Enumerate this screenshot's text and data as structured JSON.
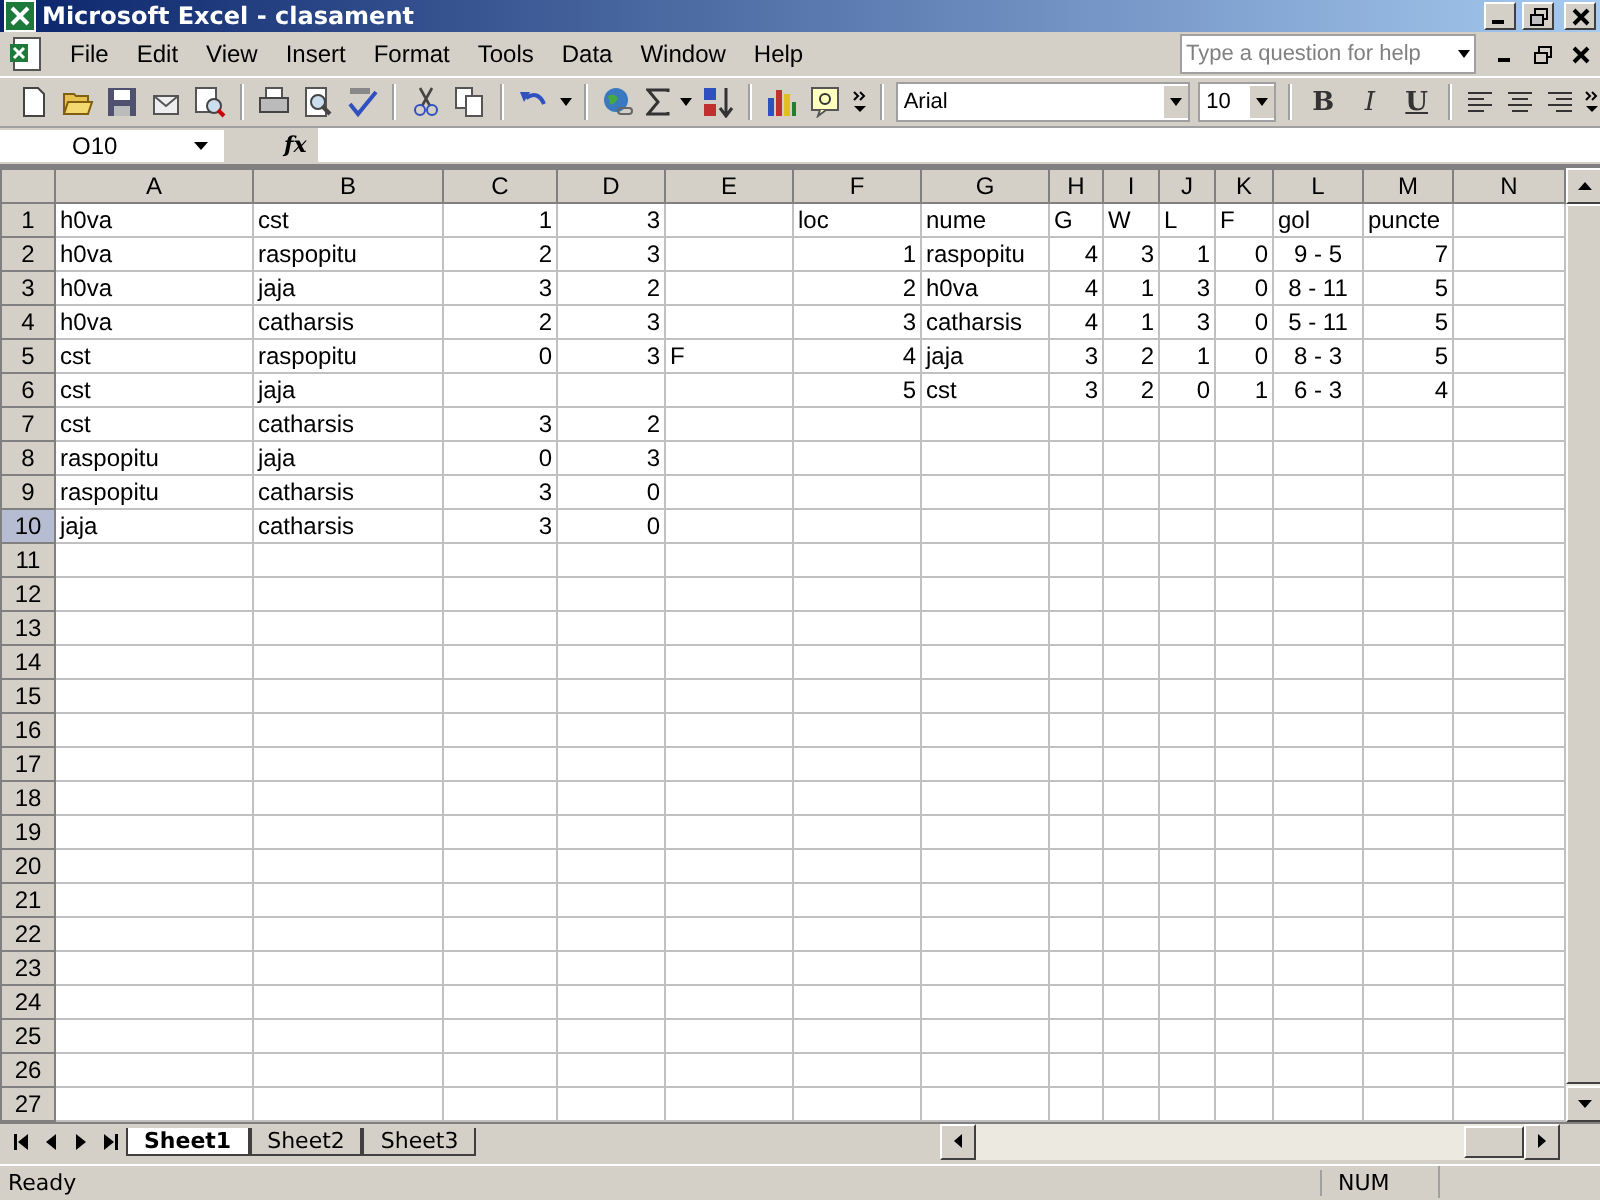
{
  "window": {
    "title": "Microsoft Excel - clasament"
  },
  "menu": [
    "File",
    "Edit",
    "View",
    "Insert",
    "Format",
    "Tools",
    "Data",
    "Window",
    "Help"
  ],
  "help_box": {
    "placeholder": "Type a question for help"
  },
  "formatting": {
    "font": "Arial",
    "size": "10",
    "bold": "B",
    "italic": "I",
    "underline": "U"
  },
  "formula_bar": {
    "name_box": "O10",
    "fx": "fx"
  },
  "columns": [
    "A",
    "B",
    "C",
    "D",
    "E",
    "F",
    "G",
    "H",
    "I",
    "J",
    "K",
    "L",
    "M",
    "N"
  ],
  "rows": [
    {
      "number": "1",
      "selected": false,
      "cells": [
        {
          "text": "h0va",
          "kind": "text"
        },
        {
          "text": "cst",
          "kind": "text"
        },
        {
          "text": "1",
          "kind": "number"
        },
        {
          "text": "3",
          "kind": "number"
        },
        null,
        {
          "text": "loc",
          "kind": "text"
        },
        {
          "text": "nume",
          "kind": "text"
        },
        {
          "text": "G",
          "kind": "text"
        },
        {
          "text": "W",
          "kind": "text"
        },
        {
          "text": "L",
          "kind": "text"
        },
        {
          "text": "F",
          "kind": "text"
        },
        {
          "text": "gol",
          "kind": "text"
        },
        {
          "text": "puncte",
          "kind": "text"
        }
      ]
    },
    {
      "number": "2",
      "selected": false,
      "cells": [
        {
          "text": "h0va",
          "kind": "text"
        },
        {
          "text": "raspopitu",
          "kind": "text"
        },
        {
          "text": "2",
          "kind": "number"
        },
        {
          "text": "3",
          "kind": "number"
        },
        null,
        {
          "text": "1",
          "kind": "number"
        },
        {
          "text": "raspopitu",
          "kind": "text"
        },
        {
          "text": "4",
          "kind": "number"
        },
        {
          "text": "3",
          "kind": "number"
        },
        {
          "text": "1",
          "kind": "number"
        },
        {
          "text": "0",
          "kind": "number"
        },
        {
          "text": "9 - 5",
          "kind": "centered"
        },
        {
          "text": "7",
          "kind": "number"
        }
      ]
    },
    {
      "number": "3",
      "selected": false,
      "cells": [
        {
          "text": "h0va",
          "kind": "text"
        },
        {
          "text": "jaja",
          "kind": "text"
        },
        {
          "text": "3",
          "kind": "number"
        },
        {
          "text": "2",
          "kind": "number"
        },
        null,
        {
          "text": "2",
          "kind": "number"
        },
        {
          "text": "h0va",
          "kind": "text"
        },
        {
          "text": "4",
          "kind": "number"
        },
        {
          "text": "1",
          "kind": "number"
        },
        {
          "text": "3",
          "kind": "number"
        },
        {
          "text": "0",
          "kind": "number"
        },
        {
          "text": "8 - 11",
          "kind": "centered"
        },
        {
          "text": "5",
          "kind": "number"
        }
      ]
    },
    {
      "number": "4",
      "selected": false,
      "cells": [
        {
          "text": "h0va",
          "kind": "text"
        },
        {
          "text": "catharsis",
          "kind": "text"
        },
        {
          "text": "2",
          "kind": "number"
        },
        {
          "text": "3",
          "kind": "number"
        },
        null,
        {
          "text": "3",
          "kind": "number"
        },
        {
          "text": "catharsis",
          "kind": "text"
        },
        {
          "text": "4",
          "kind": "number"
        },
        {
          "text": "1",
          "kind": "number"
        },
        {
          "text": "3",
          "kind": "number"
        },
        {
          "text": "0",
          "kind": "number"
        },
        {
          "text": "5 - 11",
          "kind": "centered"
        },
        {
          "text": "5",
          "kind": "number"
        }
      ]
    },
    {
      "number": "5",
      "selected": false,
      "cells": [
        {
          "text": "cst",
          "kind": "text"
        },
        {
          "text": "raspopitu",
          "kind": "text"
        },
        {
          "text": "0",
          "kind": "number"
        },
        {
          "text": "3",
          "kind": "number"
        },
        {
          "text": "F",
          "kind": "text"
        },
        {
          "text": "4",
          "kind": "number"
        },
        {
          "text": "jaja",
          "kind": "text"
        },
        {
          "text": "3",
          "kind": "number"
        },
        {
          "text": "2",
          "kind": "number"
        },
        {
          "text": "1",
          "kind": "number"
        },
        {
          "text": "0",
          "kind": "number"
        },
        {
          "text": "8 - 3",
          "kind": "centered"
        },
        {
          "text": "5",
          "kind": "number"
        }
      ]
    },
    {
      "number": "6",
      "selected": false,
      "cells": [
        {
          "text": "cst",
          "kind": "text"
        },
        {
          "text": "jaja",
          "kind": "text"
        },
        null,
        null,
        null,
        {
          "text": "5",
          "kind": "number"
        },
        {
          "text": "cst",
          "kind": "text"
        },
        {
          "text": "3",
          "kind": "number"
        },
        {
          "text": "2",
          "kind": "number"
        },
        {
          "text": "0",
          "kind": "number"
        },
        {
          "text": "1",
          "kind": "number"
        },
        {
          "text": "6 - 3",
          "kind": "centered"
        },
        {
          "text": "4",
          "kind": "number"
        }
      ]
    },
    {
      "number": "7",
      "selected": false,
      "cells": [
        {
          "text": "cst",
          "kind": "text"
        },
        {
          "text": "catharsis",
          "kind": "text"
        },
        {
          "text": "3",
          "kind": "number"
        },
        {
          "text": "2",
          "kind": "number"
        }
      ]
    },
    {
      "number": "8",
      "selected": false,
      "cells": [
        {
          "text": "raspopitu",
          "kind": "text"
        },
        {
          "text": "jaja",
          "kind": "text"
        },
        {
          "text": "0",
          "kind": "number"
        },
        {
          "text": "3",
          "kind": "number"
        }
      ]
    },
    {
      "number": "9",
      "selected": false,
      "cells": [
        {
          "text": "raspopitu",
          "kind": "text"
        },
        {
          "text": "catharsis",
          "kind": "text"
        },
        {
          "text": "3",
          "kind": "number"
        },
        {
          "text": "0",
          "kind": "number"
        }
      ]
    },
    {
      "number": "10",
      "selected": true,
      "cells": [
        {
          "text": "jaja",
          "kind": "text"
        },
        {
          "text": "catharsis",
          "kind": "text"
        },
        {
          "text": "3",
          "kind": "number"
        },
        {
          "text": "0",
          "kind": "number"
        }
      ]
    },
    {
      "number": "11",
      "selected": false
    },
    {
      "number": "12",
      "selected": false
    },
    {
      "number": "13",
      "selected": false
    },
    {
      "number": "14",
      "selected": false
    },
    {
      "number": "15",
      "selected": false
    },
    {
      "number": "16",
      "selected": false
    },
    {
      "number": "17",
      "selected": false
    },
    {
      "number": "18",
      "selected": false
    },
    {
      "number": "19",
      "selected": false
    },
    {
      "number": "20",
      "selected": false
    },
    {
      "number": "21",
      "selected": false
    },
    {
      "number": "22",
      "selected": false
    },
    {
      "number": "23",
      "selected": false
    },
    {
      "number": "24",
      "selected": false
    },
    {
      "number": "25",
      "selected": false
    },
    {
      "number": "26",
      "selected": false
    },
    {
      "number": "27",
      "selected": false
    }
  ],
  "sheet_tabs": [
    {
      "label": "Sheet1",
      "selected": true
    },
    {
      "label": "Sheet2",
      "selected": false
    },
    {
      "label": "Sheet3",
      "selected": false
    }
  ],
  "status_bar": {
    "status": "Ready",
    "num": "NUM"
  }
}
